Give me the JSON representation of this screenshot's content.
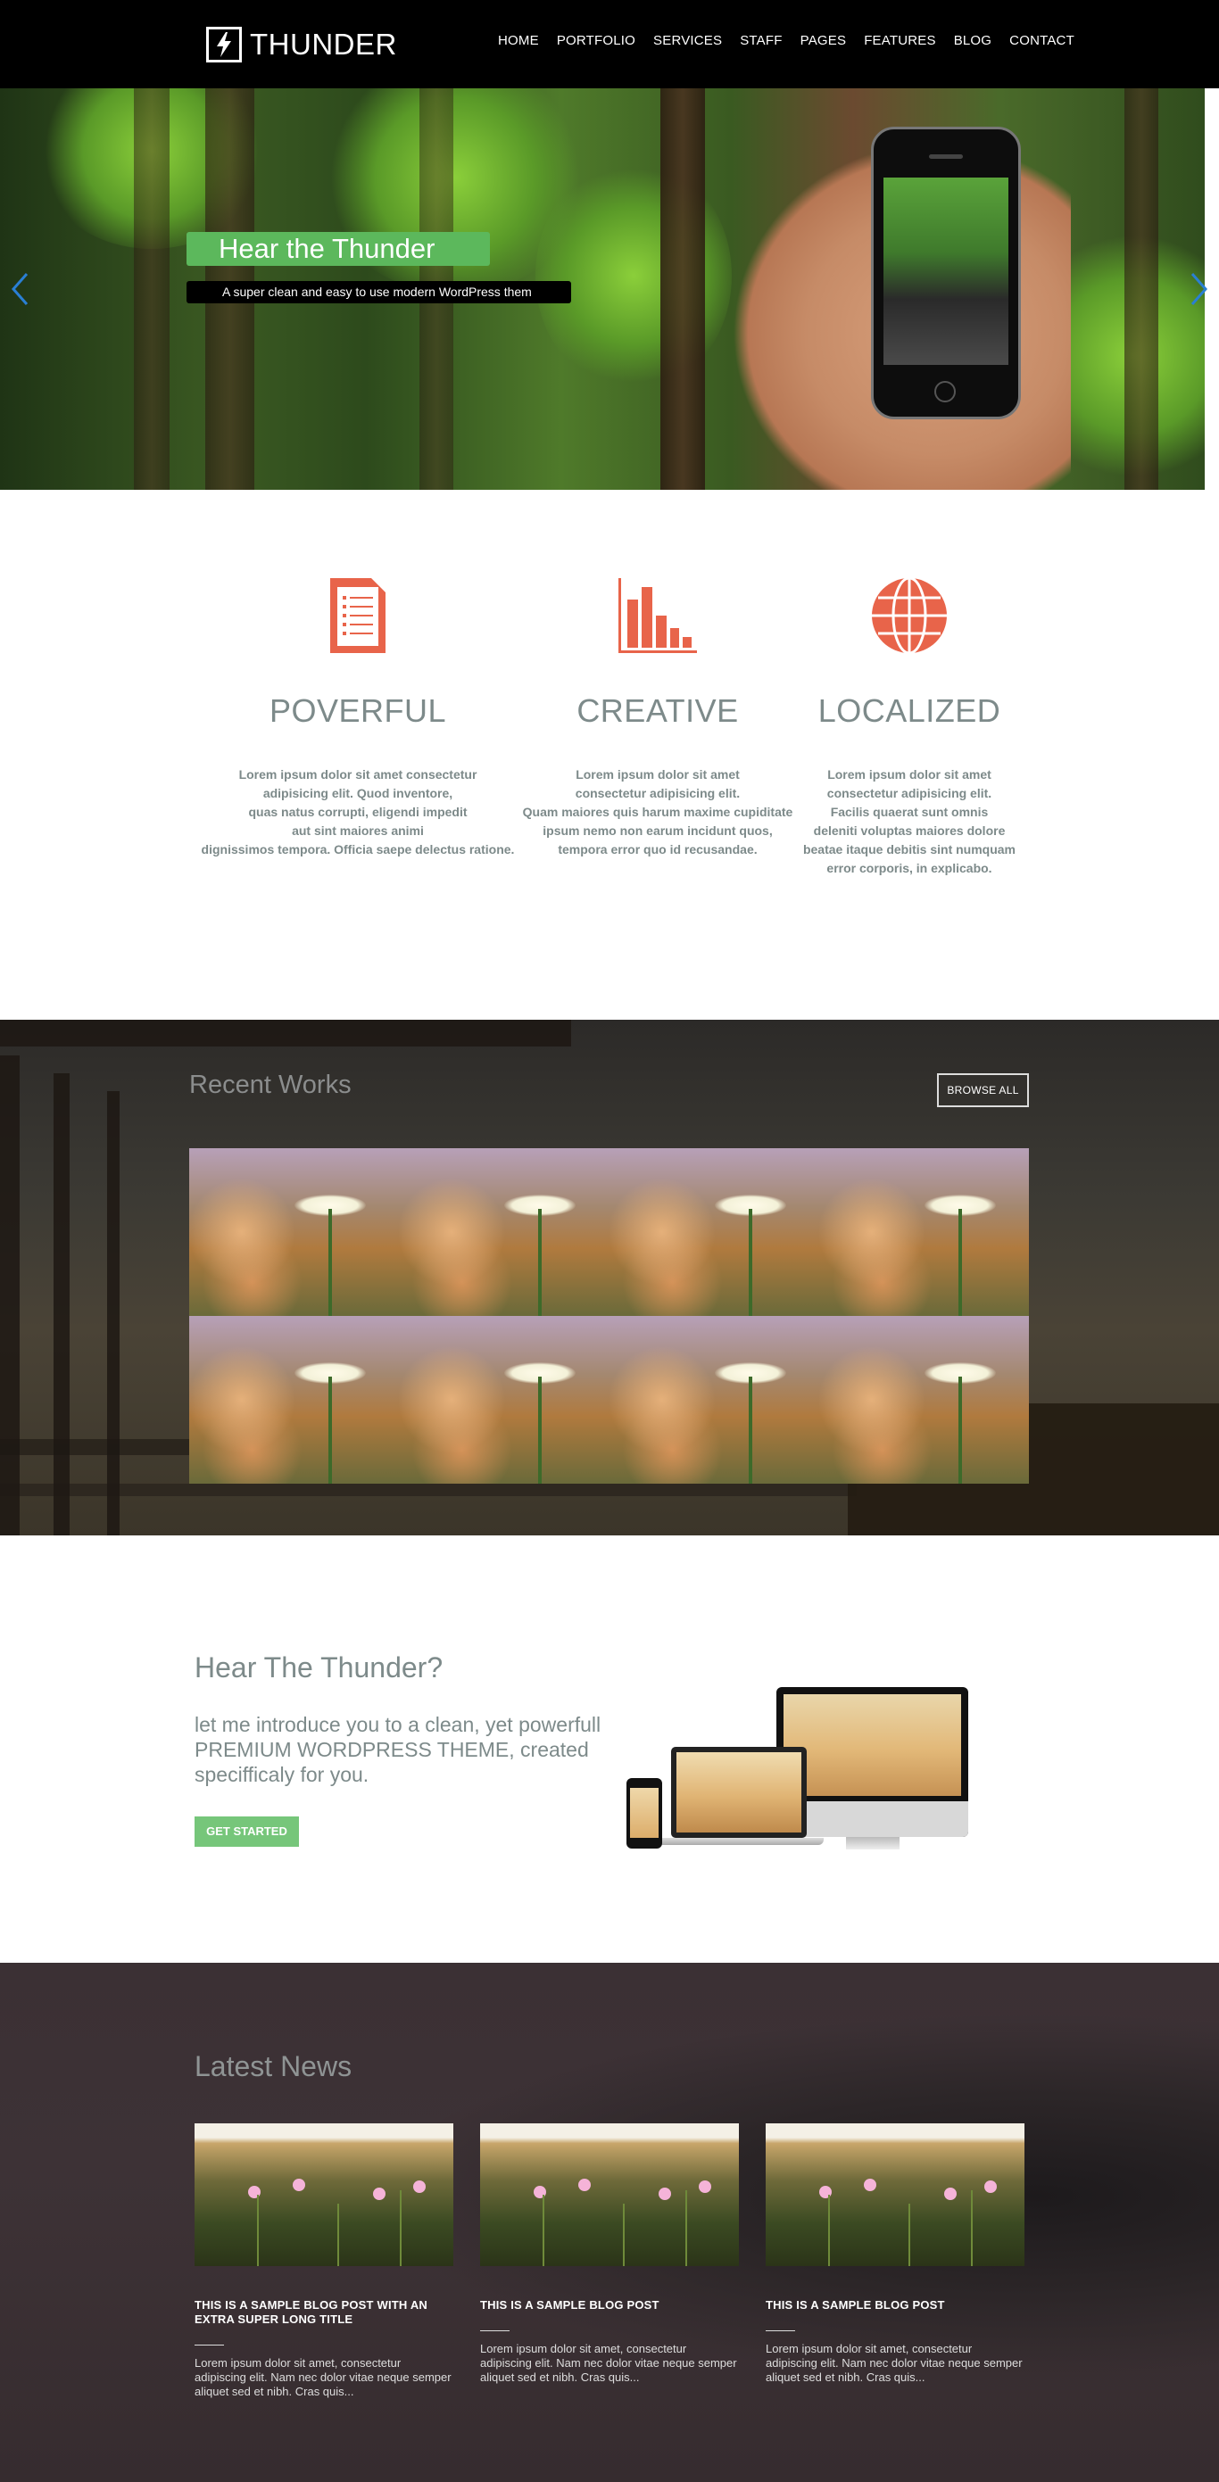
{
  "header": {
    "logo_text": "THUNDER",
    "nav": [
      "HOME",
      "PORTFOLIO",
      "SERVICES",
      "STAFF",
      "PAGES",
      "FEATURES",
      "BLOG",
      "CONTACT"
    ]
  },
  "hero": {
    "title": "Hear the Thunder",
    "subtitle": "A super clean and easy to use modern WordPress them"
  },
  "features": [
    {
      "icon": "document-icon",
      "title": "POVERFUL",
      "text": "Lorem ipsum dolor sit amet consectetur\nadipisicing elit. Quod inventore,\nquas natus corrupti, eligendi impedit\naut sint maiores animi\ndignissimos tempora. Officia saepe delectus ratione."
    },
    {
      "icon": "bar-chart-icon",
      "title": "CREATIVE",
      "text": "Lorem ipsum dolor sit amet\nconsectetur adipisicing elit.\nQuam maiores quis harum maxime cupiditate\nipsum nemo non earum incidunt quos,\ntempora error quo id recusandae."
    },
    {
      "icon": "globe-icon",
      "title": "LOCALIZED",
      "text": "Lorem ipsum dolor sit amet\nconsectetur adipisicing elit.\nFacilis quaerat sunt omnis\ndeleniti voluptas maiores dolore\nbeatae itaque debitis sint numquam\nerror corporis, in explicabo."
    }
  ],
  "works": {
    "title": "Recent Works",
    "browse_label": "BROWSE ALL"
  },
  "cta": {
    "title": "Hear The Thunder?",
    "text": "let me introduce you to a clean, yet powerfull PREMIUM WORDPRESS THEME, created specifficaly for you.",
    "button": "GET STARTED"
  },
  "news": {
    "title": "Latest News",
    "posts": [
      {
        "title": "THIS IS A SAMPLE BLOG POST WITH AN EXTRA SUPER LONG TITLE",
        "text": "Lorem ipsum dolor sit amet, consectetur adipiscing elit. Nam nec dolor vitae neque semper aliquet sed et nibh. Cras quis..."
      },
      {
        "title": "THIS IS A SAMPLE BLOG POST",
        "text": "Lorem ipsum dolor sit amet, consectetur adipiscing elit. Nam nec dolor vitae neque semper aliquet sed et nibh. Cras quis..."
      },
      {
        "title": "THIS IS A SAMPLE BLOG POST",
        "text": "Lorem ipsum dolor sit amet, consectetur adipiscing elit. Nam nec dolor vitae neque semper aliquet sed et nibh. Cras quis..."
      }
    ]
  },
  "colors": {
    "accent_green": "#5cb85c",
    "icon_orange": "#e8644a",
    "text_gray": "#7d8a8a",
    "arrow_blue": "#2a7fd4"
  }
}
